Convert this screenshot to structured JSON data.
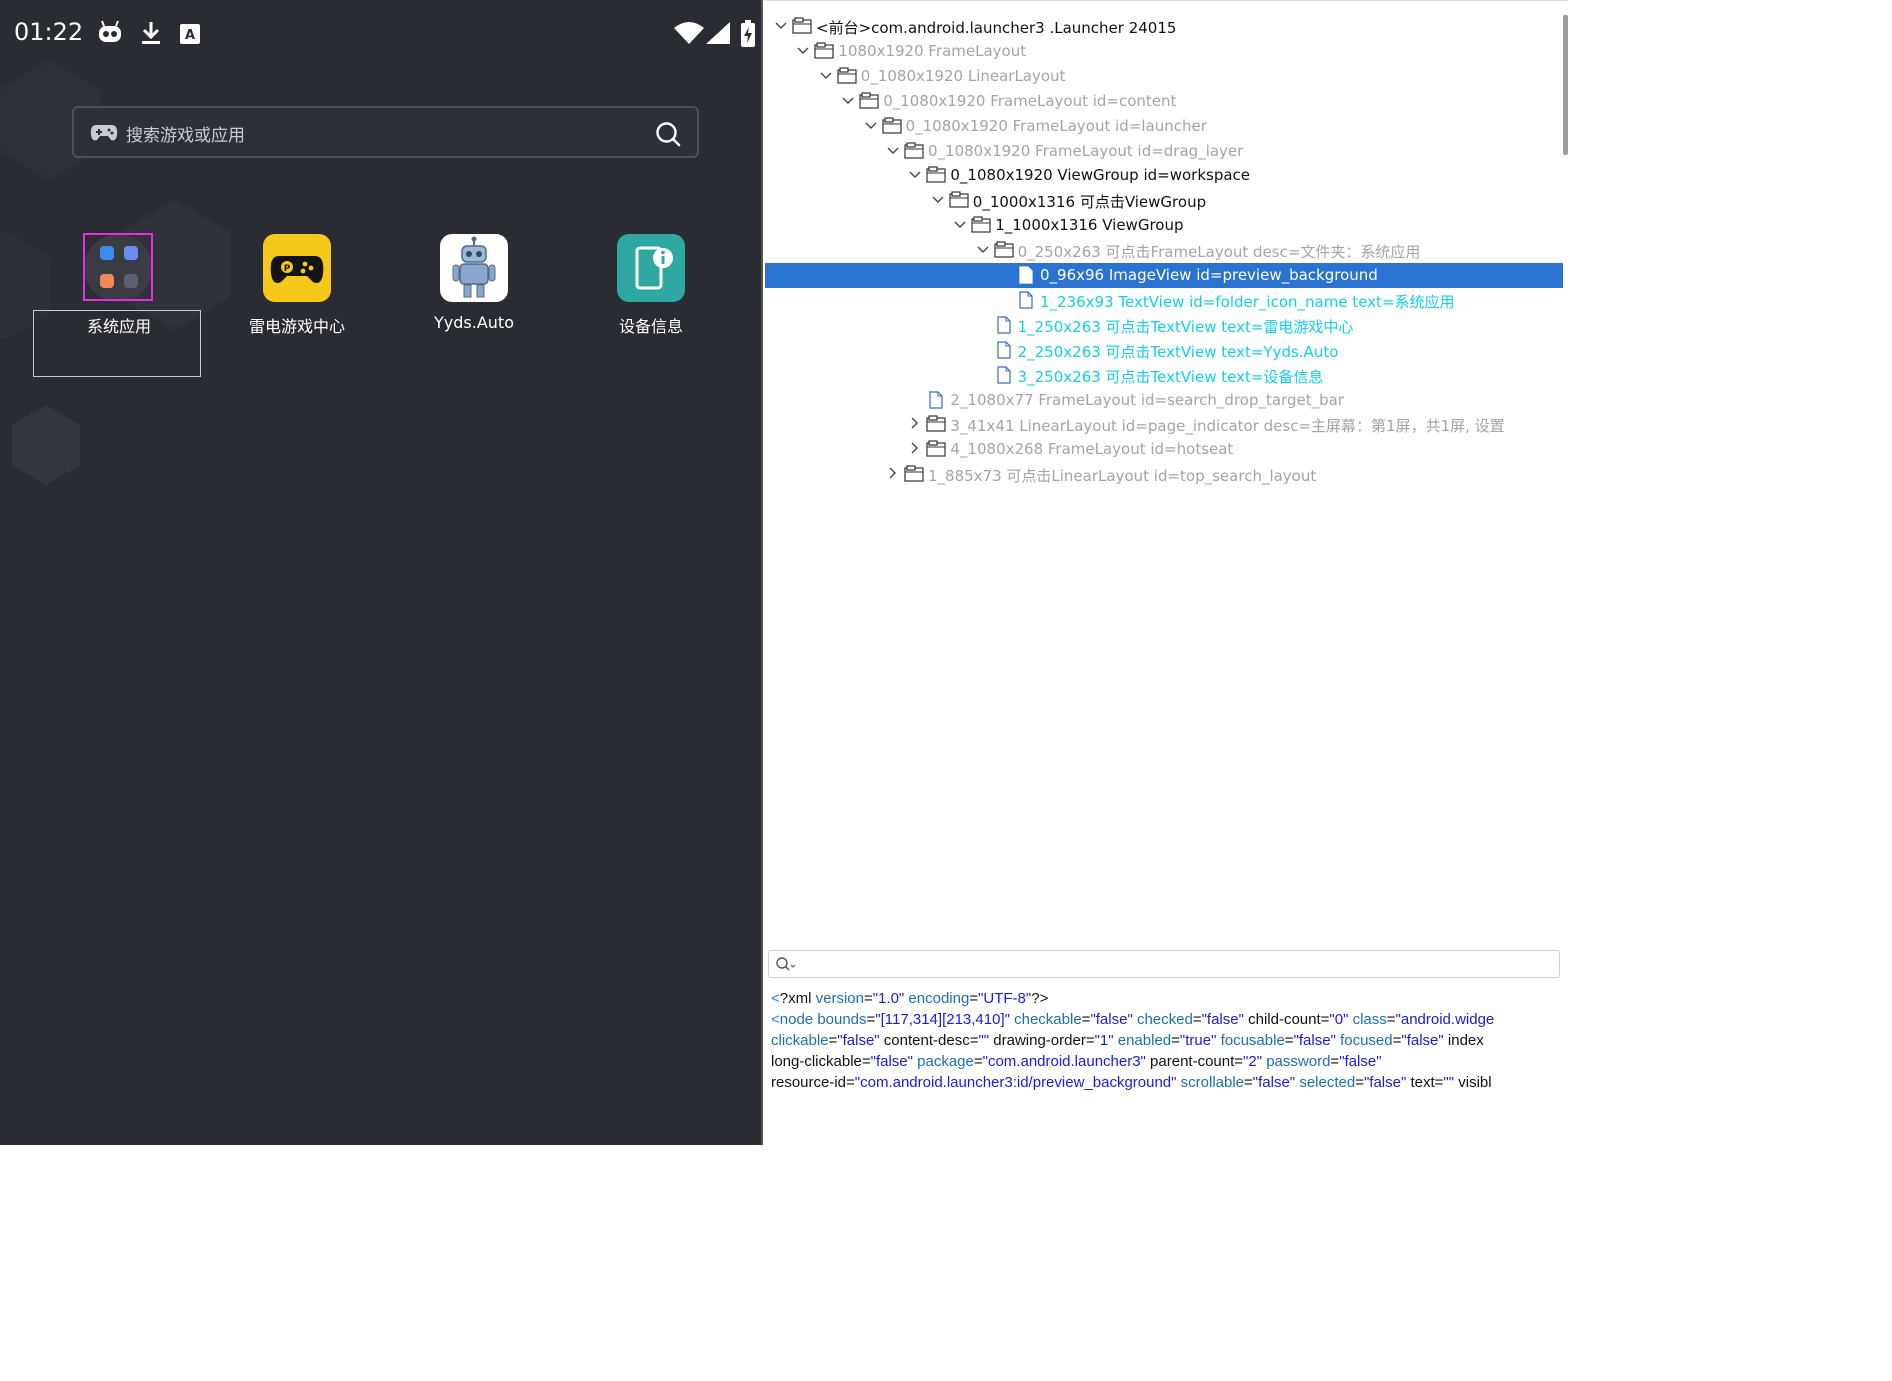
{
  "status_bar": {
    "time": "01:22",
    "icons": [
      "bot-icon",
      "download-icon",
      "text-input-icon",
      "wifi-icon",
      "signal-icon",
      "battery-charging-icon"
    ]
  },
  "search": {
    "placeholder": "搜索游戏或应用",
    "left_icon": "gamepad-icon",
    "right_icon": "search-icon"
  },
  "apps": [
    {
      "label": "系统应用",
      "icon": "folder-icon",
      "color": "#3a3c44"
    },
    {
      "label": "雷电游戏中心",
      "icon": "gamepad-icon",
      "color": "#f6c81a"
    },
    {
      "label": "Yyds.Auto",
      "icon": "robot-icon",
      "color": "#ffffff"
    },
    {
      "label": "设备信息",
      "icon": "device-info-icon",
      "color": "#2ea8a0"
    }
  ],
  "tree": [
    {
      "depth": 0,
      "expand": "open",
      "icon": "folder",
      "style": "dark",
      "text": "<前台>com.android.launcher3 .Launcher 24015"
    },
    {
      "depth": 1,
      "expand": "open",
      "icon": "folder",
      "style": "dim",
      "text": "1080x1920 FrameLayout"
    },
    {
      "depth": 2,
      "expand": "open",
      "icon": "folder",
      "style": "dim",
      "text": "0_1080x1920 LinearLayout"
    },
    {
      "depth": 3,
      "expand": "open",
      "icon": "folder",
      "style": "dim",
      "text": "0_1080x1920 FrameLayout id=content"
    },
    {
      "depth": 4,
      "expand": "open",
      "icon": "folder",
      "style": "dim",
      "text": "0_1080x1920 FrameLayout id=launcher"
    },
    {
      "depth": 5,
      "expand": "open",
      "icon": "folder",
      "style": "dim",
      "text": "0_1080x1920 FrameLayout id=drag_layer"
    },
    {
      "depth": 6,
      "expand": "open",
      "icon": "folder",
      "style": "dark",
      "text": "0_1080x1920 ViewGroup id=workspace"
    },
    {
      "depth": 7,
      "expand": "open",
      "icon": "folder",
      "style": "dark",
      "text": "0_1000x1316 可点击ViewGroup"
    },
    {
      "depth": 8,
      "expand": "open",
      "icon": "folder",
      "style": "dark",
      "text": "1_1000x1316 ViewGroup"
    },
    {
      "depth": 9,
      "expand": "open",
      "icon": "folder",
      "style": "dim",
      "text": "0_250x263 可点击FrameLayout  desc=文件夹：系统应用"
    },
    {
      "depth": 10,
      "expand": "none",
      "icon": "file",
      "style": "selected",
      "text": "0_96x96 ImageView id=preview_background"
    },
    {
      "depth": 10,
      "expand": "none",
      "icon": "file",
      "style": "cyan",
      "text": "1_236x93 TextView id=folder_icon_name  text=系统应用"
    },
    {
      "depth": 9,
      "expand": "none",
      "icon": "file",
      "style": "cyan",
      "text": "1_250x263 可点击TextView   text=雷电游戏中心"
    },
    {
      "depth": 9,
      "expand": "none",
      "icon": "file",
      "style": "cyan",
      "text": "2_250x263 可点击TextView   text=Yyds.Auto"
    },
    {
      "depth": 9,
      "expand": "none",
      "icon": "file",
      "style": "cyan",
      "text": "3_250x263 可点击TextView   text=设备信息"
    },
    {
      "depth": 6,
      "expand": "none",
      "icon": "file",
      "style": "dim",
      "text": "2_1080x77 FrameLayout id=search_drop_target_bar"
    },
    {
      "depth": 6,
      "expand": "closed",
      "icon": "folder",
      "style": "dim",
      "text": "3_41x41 LinearLayout id=page_indicator desc=主屏幕：第1屏，共1屏, 设置"
    },
    {
      "depth": 6,
      "expand": "closed",
      "icon": "folder",
      "style": "dim",
      "text": "4_1080x268 FrameLayout id=hotseat"
    },
    {
      "depth": 5,
      "expand": "closed",
      "icon": "folder",
      "style": "dim",
      "text": "1_885x73 可点击LinearLayout id=top_search_layout"
    }
  ],
  "filter": {
    "placeholder": "",
    "icon": "search-icon"
  },
  "xml": {
    "lines": [
      [
        [
          "pp",
          "<"
        ],
        [
          "an",
          "?xml "
        ],
        [
          "tag",
          "version"
        ],
        [
          "an",
          "="
        ],
        [
          "av",
          "\"1.0\""
        ],
        [
          "an",
          " "
        ],
        [
          "tag",
          "encoding"
        ],
        [
          "an",
          "="
        ],
        [
          "av",
          "\"UTF-8\""
        ],
        [
          "an",
          "?>"
        ]
      ],
      [
        [
          "pp",
          "<"
        ],
        [
          "tag",
          "node "
        ],
        [
          "tag",
          "bounds"
        ],
        [
          "an",
          "="
        ],
        [
          "av",
          "\"[117,314][213,410]\""
        ],
        [
          "an",
          " "
        ],
        [
          "tag",
          "checkable"
        ],
        [
          "an",
          "="
        ],
        [
          "av",
          "\"false\""
        ],
        [
          "an",
          " "
        ],
        [
          "tag",
          "checked"
        ],
        [
          "an",
          "="
        ],
        [
          "av",
          "\"false\""
        ],
        [
          "an",
          " child-count="
        ],
        [
          "av",
          "\"0\""
        ],
        [
          "an",
          " "
        ],
        [
          "tag",
          "class"
        ],
        [
          "an",
          "="
        ],
        [
          "av",
          "\"android.widge"
        ]
      ],
      [
        [
          "an",
          " "
        ],
        [
          "tag",
          "clickable"
        ],
        [
          "an",
          "="
        ],
        [
          "av",
          "\"false\""
        ],
        [
          "an",
          " content-desc="
        ],
        [
          "av",
          "\"\""
        ],
        [
          "an",
          " drawing-order="
        ],
        [
          "av",
          "\"1\""
        ],
        [
          "an",
          " "
        ],
        [
          "tag",
          "enabled"
        ],
        [
          "an",
          "="
        ],
        [
          "av",
          "\"true\""
        ],
        [
          "an",
          " "
        ],
        [
          "tag",
          "focusable"
        ],
        [
          "an",
          "="
        ],
        [
          "av",
          "\"false\""
        ],
        [
          "an",
          " "
        ],
        [
          "tag",
          "focused"
        ],
        [
          "an",
          "="
        ],
        [
          "av",
          "\"false\""
        ],
        [
          "an",
          " index"
        ]
      ],
      [
        [
          "an",
          " long-clickable="
        ],
        [
          "av",
          "\"false\""
        ],
        [
          "an",
          " "
        ],
        [
          "tag",
          "package"
        ],
        [
          "an",
          "="
        ],
        [
          "av",
          "\"com.android.launcher3\""
        ],
        [
          "an",
          " parent-count="
        ],
        [
          "av",
          "\"2\""
        ],
        [
          "an",
          " "
        ],
        [
          "tag",
          "password"
        ],
        [
          "an",
          "="
        ],
        [
          "av",
          "\"false\""
        ]
      ],
      [
        [
          "an",
          " resource-id="
        ],
        [
          "av",
          "\"com.android.launcher3:id/preview_background\""
        ],
        [
          "an",
          " "
        ],
        [
          "tag",
          "scrollable"
        ],
        [
          "an",
          "="
        ],
        [
          "av",
          "\"false\""
        ],
        [
          "an",
          " "
        ],
        [
          "tag",
          "selected"
        ],
        [
          "an",
          "="
        ],
        [
          "av",
          "\"false\""
        ],
        [
          "an",
          " text="
        ],
        [
          "av",
          "\"\""
        ],
        [
          "an",
          " visibl"
        ]
      ]
    ]
  }
}
